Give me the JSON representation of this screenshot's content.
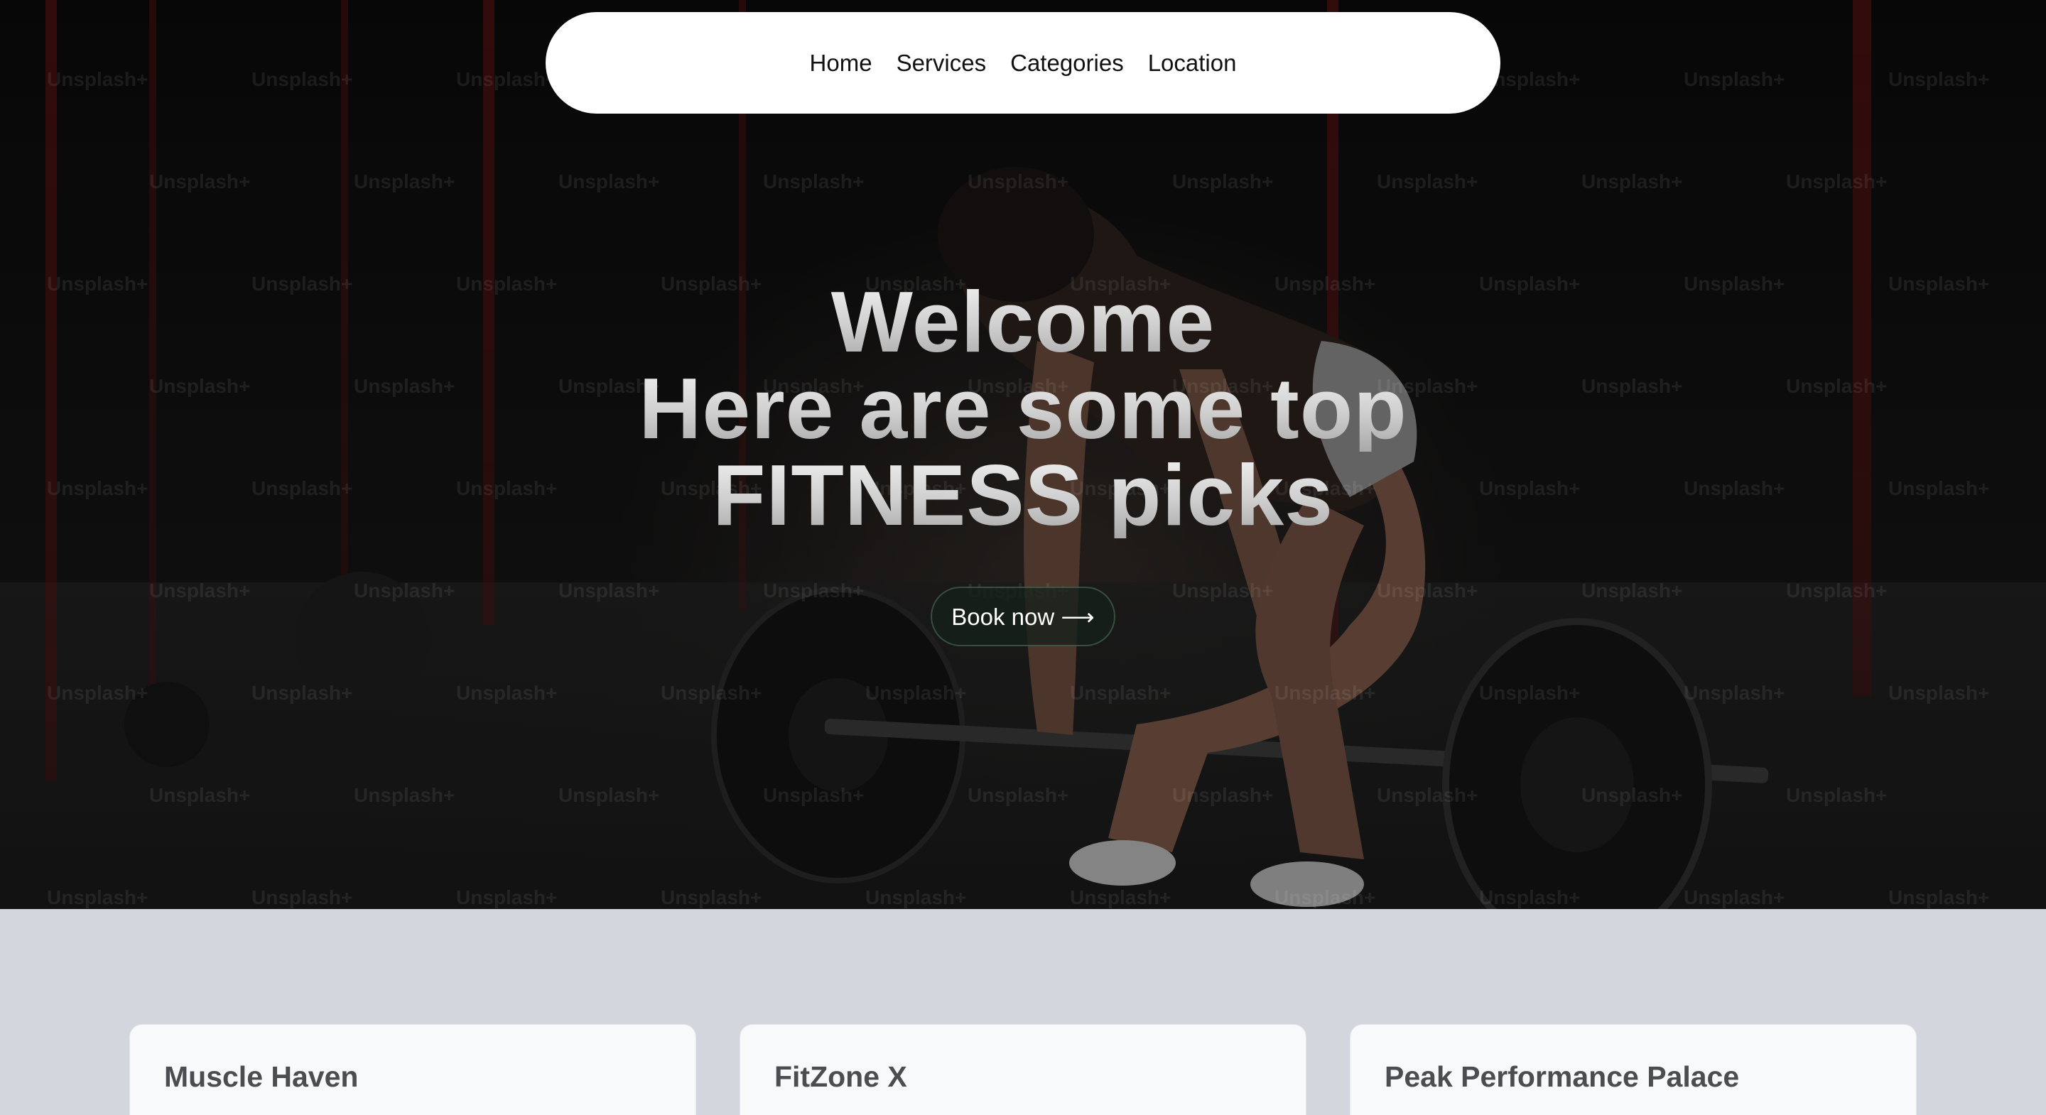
{
  "nav": {
    "items": [
      "Home",
      "Services",
      "Categories",
      "Location"
    ]
  },
  "hero": {
    "line1": "Welcome",
    "line2": "Here are some top",
    "line3": "FITNESS picks",
    "cta_label": "Book now ⟶",
    "watermark": "Unsplash+"
  },
  "cards": [
    {
      "title": "Muscle Haven"
    },
    {
      "title": "FitZone X"
    },
    {
      "title": "Peak Performance Palace"
    }
  ],
  "colors": {
    "page_background": "#d3d6dc",
    "nav_background": "#ffffff",
    "card_background": "#f8f9fb",
    "card_title": "#4b4d50"
  }
}
